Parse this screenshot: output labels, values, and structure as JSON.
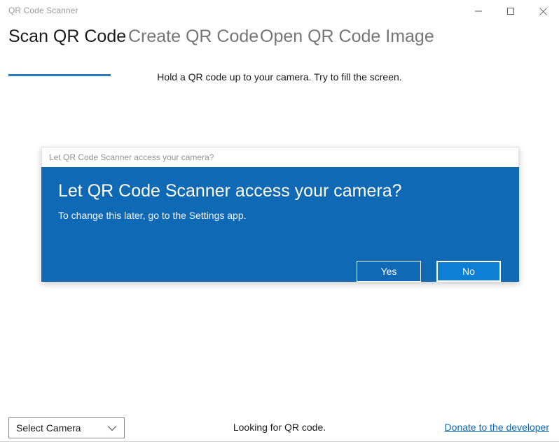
{
  "window": {
    "title": "QR Code Scanner",
    "controls": {
      "minimize": "minimize-icon",
      "maximize": "maximize-icon",
      "close": "close-icon"
    }
  },
  "tabs": [
    {
      "label": "Scan QR Code",
      "active": true
    },
    {
      "label": "Create QR Code",
      "active": false
    },
    {
      "label": "Open QR Code Image",
      "active": false
    }
  ],
  "main": {
    "hint": "Hold a QR code up to your camera. Try to fill the screen."
  },
  "dialog": {
    "titlestrip": "Let QR Code Scanner access your camera?",
    "heading": "Let QR Code Scanner access your camera?",
    "subtext": "To change this later, go to the Settings app.",
    "yes_label": "Yes",
    "no_label": "No"
  },
  "bottom": {
    "camera_select_value": "Select Camera",
    "chevron": "chevron-down-icon",
    "status": "Looking for QR code.",
    "donate_label": "Donate to the developer"
  },
  "colors": {
    "accent": "#2a7bc0",
    "dialog_blue": "#1069b4",
    "button_focus_blue": "#0d7fd4",
    "link_blue": "#1069b4",
    "inactive_tab": "#767676"
  }
}
